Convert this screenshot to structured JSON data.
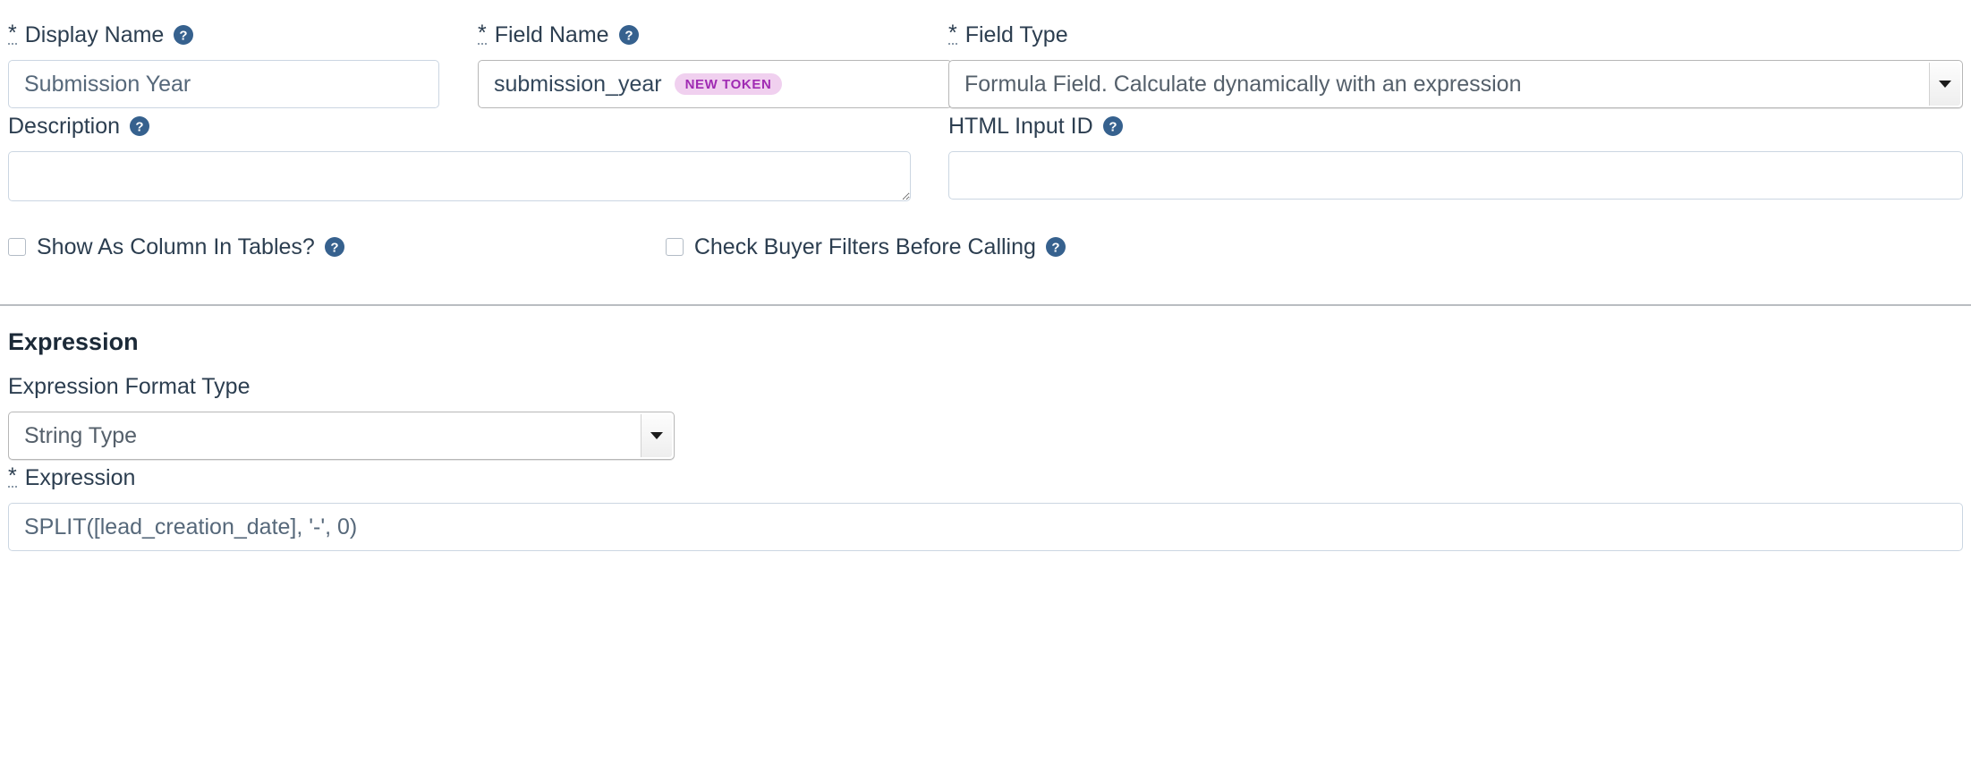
{
  "form": {
    "display_name": {
      "label": "Display Name",
      "required_marker": "*",
      "required": true,
      "value": "",
      "placeholder": "Submission Year",
      "help_icon": "help-circle-icon"
    },
    "field_name": {
      "label": "Field Name",
      "required_marker": "*",
      "required": true,
      "value": "submission_year",
      "badge": "NEW TOKEN",
      "badge_bg": "#f0d0ef",
      "badge_color": "#a02bb3",
      "help_icon": "help-circle-icon"
    },
    "field_type": {
      "label": "Field Type",
      "required_marker": "*",
      "required": true,
      "selected": "Formula Field. Calculate dynamically with an expression",
      "arrow_icon": "caret-down-icon"
    },
    "description": {
      "label": "Description",
      "required": false,
      "value": "",
      "placeholder": "",
      "help_icon": "help-circle-icon",
      "resize_handle": "resize-grip-icon"
    },
    "html_input_id": {
      "label": "HTML Input ID",
      "required": false,
      "value": "",
      "placeholder": "",
      "help_icon": "help-circle-icon"
    },
    "checkboxes": [
      {
        "label": "Show As Column In Tables?",
        "checked": false,
        "help_icon": "help-circle-icon"
      },
      {
        "label": "Check Buyer Filters Before Calling",
        "checked": false,
        "help_icon": "help-circle-icon"
      }
    ]
  },
  "expression_section": {
    "title": "Expression",
    "format_type": {
      "label": "Expression Format Type",
      "required": false,
      "selected": "String Type",
      "arrow_icon": "caret-down-icon"
    },
    "expression": {
      "label": "Expression",
      "required_marker": "*",
      "required": true,
      "value": "",
      "placeholder": "SPLIT([lead_creation_date], '-', 0)"
    }
  },
  "theme": {
    "help_icon_color": "#36618e",
    "border_color": "#cbd6e2",
    "text_color": "#33475b",
    "divider_color": "#b9bdc1",
    "background": "#ffffff"
  }
}
